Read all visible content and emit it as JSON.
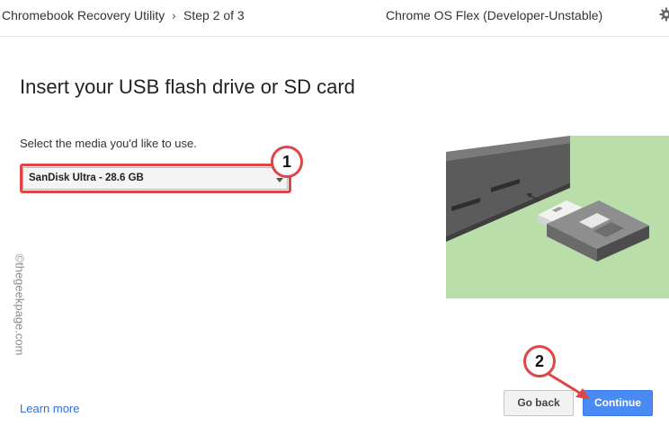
{
  "header": {
    "app_title": "Chromebook Recovery Utility",
    "separator": "›",
    "step": "Step 2 of 3",
    "model": "Chrome OS Flex (Developer-Unstable)",
    "settings_icon": "gear-icon"
  },
  "main": {
    "title": "Insert your USB flash drive or SD card",
    "prompt": "Select the media you'd like to use.",
    "media_select": {
      "selected": "SanDisk Ultra - 28.6 GB"
    },
    "learn_more": "Learn more"
  },
  "buttons": {
    "back": "Go back",
    "continue": "Continue"
  },
  "annotations": {
    "badge1": "1",
    "badge2": "2",
    "highlight_color": "#e04545",
    "watermark": "©thegeekpage.com"
  },
  "colors": {
    "accent": "#4a8af4",
    "illustration_bg": "#b9dea9"
  }
}
